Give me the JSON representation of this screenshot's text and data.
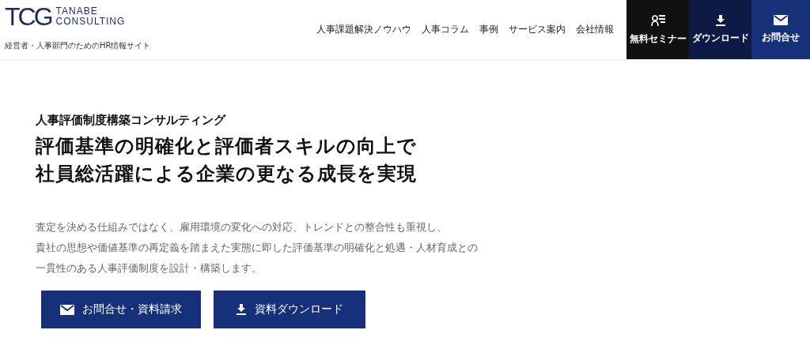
{
  "header": {
    "logo": {
      "mark": "TCG",
      "line_1": "TANABE",
      "line_2": "CONSULTING"
    },
    "tagline": "経営者・人事部門のためのHR情報サイト",
    "nav": [
      "人事課題解決ノウハウ",
      "人事コラム",
      "事例",
      "サービス案内",
      "会社情報"
    ],
    "actions": [
      {
        "kind": "seminar",
        "label": "無料セミナー"
      },
      {
        "kind": "download",
        "label": "ダウンロード"
      },
      {
        "kind": "mail",
        "label": "お問合せ"
      }
    ]
  },
  "hero": {
    "eyebrow": "人事評価制度構築コンサルティング",
    "headline": [
      "評価基準の明確化と評価者スキルの向上で",
      "社員総活躍による企業の更なる成長を実現"
    ],
    "body": [
      "査定を決める仕組みではなく、雇用環境の変化への対応、トレンドとの整合性も重視し、",
      "貴社の思想や価値基準の再定義を踏まえた実態に即した評価基準の明確化と処遇・人材育成との",
      "一貫性のある人事評価制度を設計・構築します。"
    ],
    "buttons": [
      {
        "kind": "mail",
        "label": "お問合せ・資料請求"
      },
      {
        "kind": "download",
        "label": "資料ダウンロード"
      }
    ]
  }
}
